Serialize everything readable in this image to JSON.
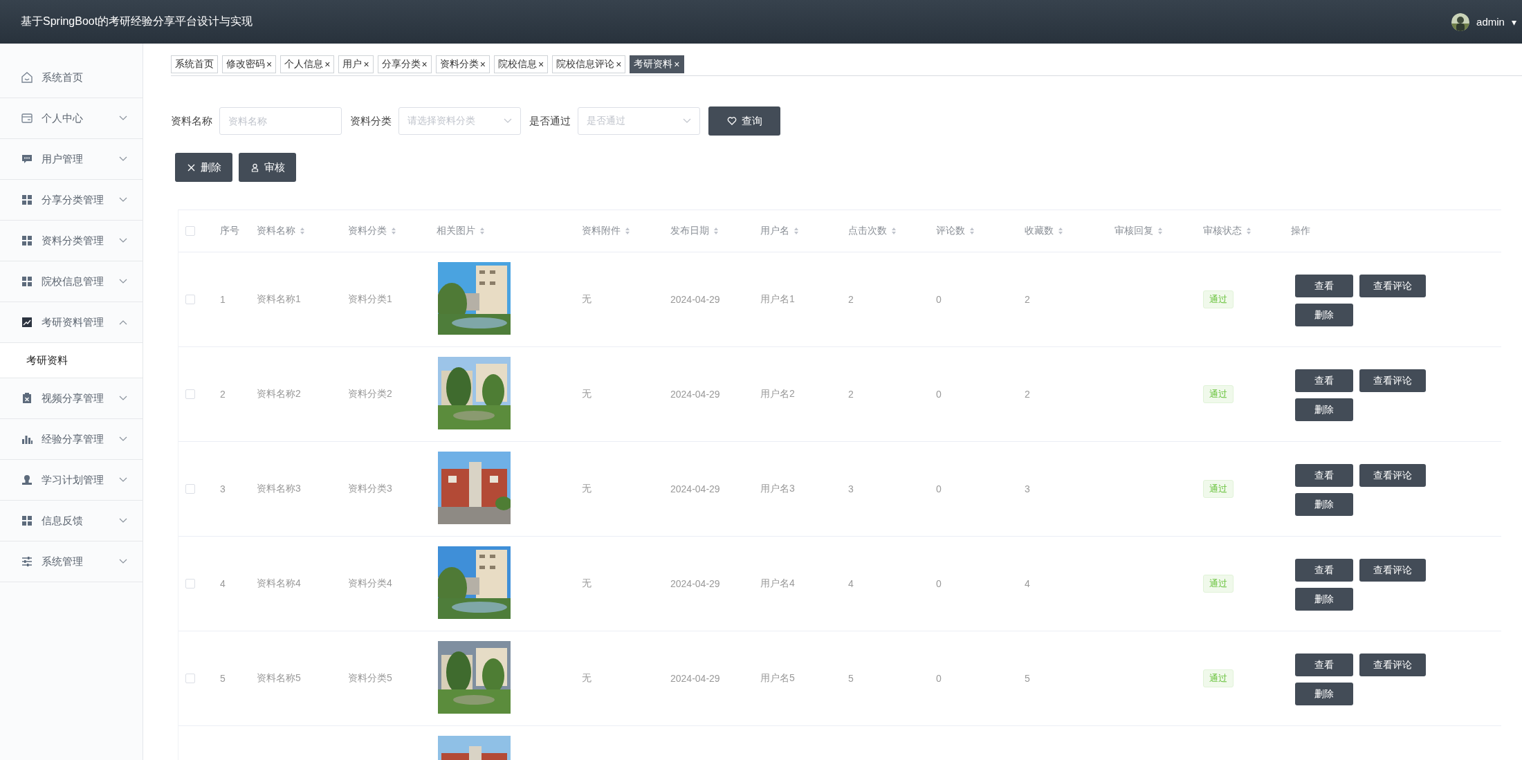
{
  "header": {
    "title": "基于SpringBoot的考研经验分享平台设计与实现",
    "user": "admin",
    "caret": "▾"
  },
  "sidebar": {
    "items": [
      {
        "label": "系统首页"
      },
      {
        "label": "个人中心",
        "expanded": false
      },
      {
        "label": "用户管理",
        "expanded": false
      },
      {
        "label": "分享分类管理",
        "expanded": false
      },
      {
        "label": "资料分类管理",
        "expanded": false
      },
      {
        "label": "院校信息管理",
        "expanded": false
      },
      {
        "label": "考研资料管理",
        "expanded": true,
        "children": [
          {
            "label": "考研资料",
            "selected": true
          }
        ]
      },
      {
        "label": "视频分享管理",
        "expanded": false
      },
      {
        "label": "经验分享管理",
        "expanded": false
      },
      {
        "label": "学习计划管理",
        "expanded": false
      },
      {
        "label": "信息反馈",
        "expanded": false
      },
      {
        "label": "系统管理",
        "expanded": false
      }
    ]
  },
  "tabs": [
    {
      "label": "系统首页",
      "selected": false
    },
    {
      "label": "修改密码",
      "close": "×",
      "selected": false
    },
    {
      "label": "个人信息",
      "close": "×",
      "selected": false
    },
    {
      "label": "用户",
      "close": "×",
      "selected": false
    },
    {
      "label": "分享分类",
      "close": "×",
      "selected": false
    },
    {
      "label": "资料分类",
      "close": "×",
      "selected": false
    },
    {
      "label": "院校信息",
      "close": "×",
      "selected": false
    },
    {
      "label": "院校信息评论",
      "close": "×",
      "selected": false
    },
    {
      "label": "考研资料",
      "close": "×",
      "selected": true
    }
  ],
  "filters": [
    {
      "kind": "input",
      "label": "资料名称",
      "placeholder": "资料名称"
    },
    {
      "kind": "select",
      "label": "资料分类",
      "placeholder": "请选择资料分类"
    },
    {
      "kind": "select",
      "label": "是否通过",
      "placeholder": "是否通过"
    }
  ],
  "search_button": "查询",
  "action_buttons": [
    {
      "kind": "delete",
      "label": "删除"
    },
    {
      "kind": "review",
      "label": "审核"
    }
  ],
  "table": {
    "columns": [
      {
        "label": "序号",
        "sortable": false
      },
      {
        "label": "资料名称",
        "sortable": true
      },
      {
        "label": "资料分类",
        "sortable": true
      },
      {
        "label": "相关图片",
        "sortable": true
      },
      {
        "label": "资料附件",
        "sortable": true
      },
      {
        "label": "发布日期",
        "sortable": true
      },
      {
        "label": "用户名",
        "sortable": true
      },
      {
        "label": "点击次数",
        "sortable": true
      },
      {
        "label": "评论数",
        "sortable": true
      },
      {
        "label": "收藏数",
        "sortable": true
      },
      {
        "label": "审核回复",
        "sortable": true
      },
      {
        "label": "审核状态",
        "sortable": true
      },
      {
        "label": "操作",
        "sortable": false
      }
    ],
    "rows": [
      {
        "checked": false,
        "cells": [
          "1",
          "资料名称1",
          "资料分类1",
          {
            "kind": "picture"
          },
          "无",
          "2024-04-29",
          "用户名1",
          "2",
          "0",
          "2",
          ""
        ],
        "status": "通过",
        "actions": [
          "查看",
          "查看评论",
          "删除"
        ]
      },
      {
        "checked": false,
        "cells": [
          "2",
          "资料名称2",
          "资料分类2",
          {
            "kind": "picture"
          },
          "无",
          "2024-04-29",
          "用户名2",
          "2",
          "0",
          "2",
          ""
        ],
        "status": "通过",
        "actions": [
          "查看",
          "查看评论",
          "删除"
        ]
      },
      {
        "checked": false,
        "cells": [
          "3",
          "资料名称3",
          "资料分类3",
          {
            "kind": "picture"
          },
          "无",
          "2024-04-29",
          "用户名3",
          "3",
          "0",
          "3",
          ""
        ],
        "status": "通过",
        "actions": [
          "查看",
          "查看评论",
          "删除"
        ]
      },
      {
        "checked": false,
        "cells": [
          "4",
          "资料名称4",
          "资料分类4",
          {
            "kind": "picture"
          },
          "无",
          "2024-04-29",
          "用户名4",
          "4",
          "0",
          "4",
          ""
        ],
        "status": "通过",
        "actions": [
          "查看",
          "查看评论",
          "删除"
        ]
      },
      {
        "checked": false,
        "cells": [
          "5",
          "资料名称5",
          "资料分类5",
          {
            "kind": "picture"
          },
          "无",
          "2024-04-29",
          "用户名5",
          "5",
          "0",
          "5",
          ""
        ],
        "status": "通过",
        "actions": [
          "查看",
          "查看评论",
          "删除"
        ]
      },
      {
        "cells": [
          "",
          "",
          "",
          {
            "kind": "picture"
          },
          "",
          "",
          "",
          "",
          "",
          "",
          ""
        ],
        "actions": []
      }
    ],
    "all_checked": false
  }
}
